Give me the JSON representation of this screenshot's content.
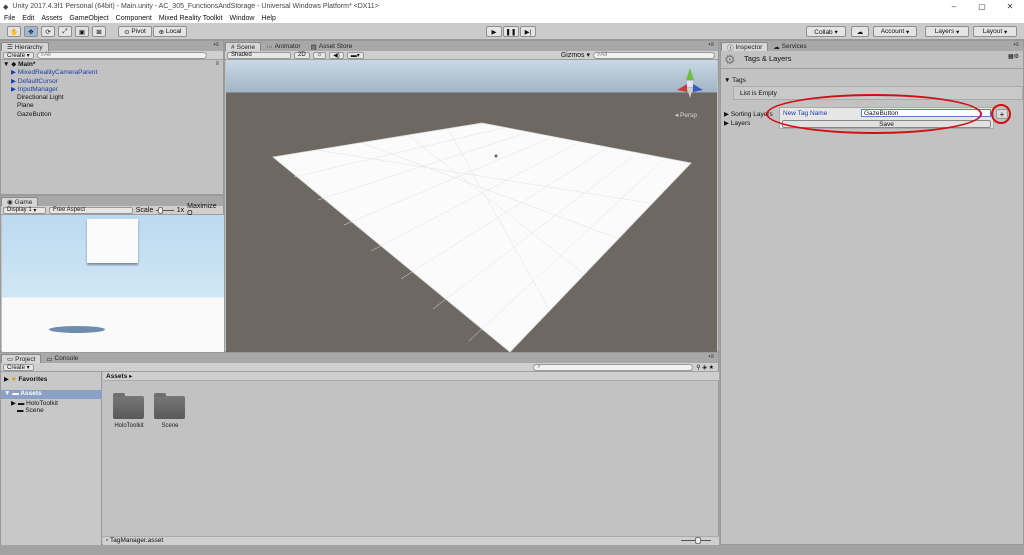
{
  "window": {
    "title": "Unity 2017.4.3f1 Personal (64bit) - Main.unity - AC_305_FunctionsAndStorage - Universal Windows Platform* <DX11>",
    "minimize": "–",
    "maximize": "▢",
    "close": "✕"
  },
  "menu": [
    "File",
    "Edit",
    "Assets",
    "GameObject",
    "Component",
    "Mixed Reality Toolkit",
    "Window",
    "Help"
  ],
  "toolbar": {
    "pivot": "Pivot",
    "local": "Local",
    "play": "▶",
    "pause": "❚❚",
    "step": "▶|",
    "collab": "Collab ▾",
    "cloud": "☁",
    "account": "Account",
    "layers": "Layers",
    "layout": "Layout"
  },
  "hierarchy": {
    "tab": "Hierarchy",
    "create": "Create ▾",
    "search_placeholder": "All",
    "scene": "Main*",
    "items": [
      {
        "label": "MixedRealityCameraParent"
      },
      {
        "label": "DefaultCursor"
      },
      {
        "label": "InputManager"
      },
      {
        "label": "Directional Light"
      },
      {
        "label": "Plane"
      },
      {
        "label": "GazeButton"
      }
    ]
  },
  "scene": {
    "tabs": [
      "Scene",
      "Animator",
      "Asset Store"
    ],
    "shading": "Shaded",
    "mode_2d": "2D",
    "gizmos": "Gizmos ▾",
    "search_placeholder": "All",
    "persp": "Persp"
  },
  "game": {
    "tab": "Game",
    "display": "Display 1",
    "aspect": "Free Aspect",
    "scale_label": "Scale",
    "scale_value": "1x",
    "maximize": "Maximize O"
  },
  "project": {
    "tabs": [
      "Project",
      "Console"
    ],
    "create": "Create ▾",
    "favorites": "Favorites",
    "assets_root": "Assets",
    "tree": [
      "HoloToolkit",
      "Scene"
    ],
    "breadcrumb": "Assets ▸",
    "folders": [
      "HoloToolkit",
      "Scene"
    ],
    "footer": "TagManager.asset"
  },
  "inspector": {
    "tabs": [
      "Inspector",
      "Services"
    ],
    "title": "Tags & Layers",
    "tags_label": "Tags",
    "list_empty": "List is Empty",
    "new_tag_label": "New Tag Name",
    "new_tag_value": "GazeButton",
    "save": "Save",
    "add": "+",
    "sorting_layers": "Sorting Layers",
    "layers": "Layers"
  },
  "colors": {
    "highlight": "#d01010",
    "link_blue": "#1a3fa8"
  }
}
